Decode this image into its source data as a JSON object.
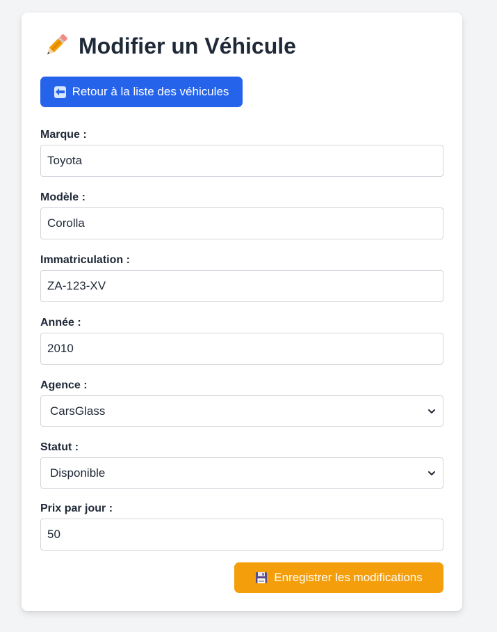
{
  "page": {
    "title": "Modifier un Véhicule",
    "title_icon": "pencil-icon"
  },
  "back_button": {
    "label": "Retour à la liste des véhicules",
    "icon": "left-arrow-icon"
  },
  "form": {
    "marque": {
      "label": "Marque :",
      "value": "Toyota"
    },
    "modele": {
      "label": "Modèle :",
      "value": "Corolla"
    },
    "immatriculation": {
      "label": "Immatriculation :",
      "value": "ZA-123-XV"
    },
    "annee": {
      "label": "Année :",
      "value": "2010"
    },
    "agence": {
      "label": "Agence :",
      "selected": "CarsGlass"
    },
    "statut": {
      "label": "Statut :",
      "selected": "Disponible"
    },
    "prix": {
      "label": "Prix par jour :",
      "value": "50"
    }
  },
  "save_button": {
    "label": "Enregistrer les modifications",
    "icon": "floppy-disk-icon"
  },
  "colors": {
    "primary": "#2563eb",
    "warning": "#f59e0b",
    "background": "#f3f4f6",
    "text": "#1f2937"
  }
}
